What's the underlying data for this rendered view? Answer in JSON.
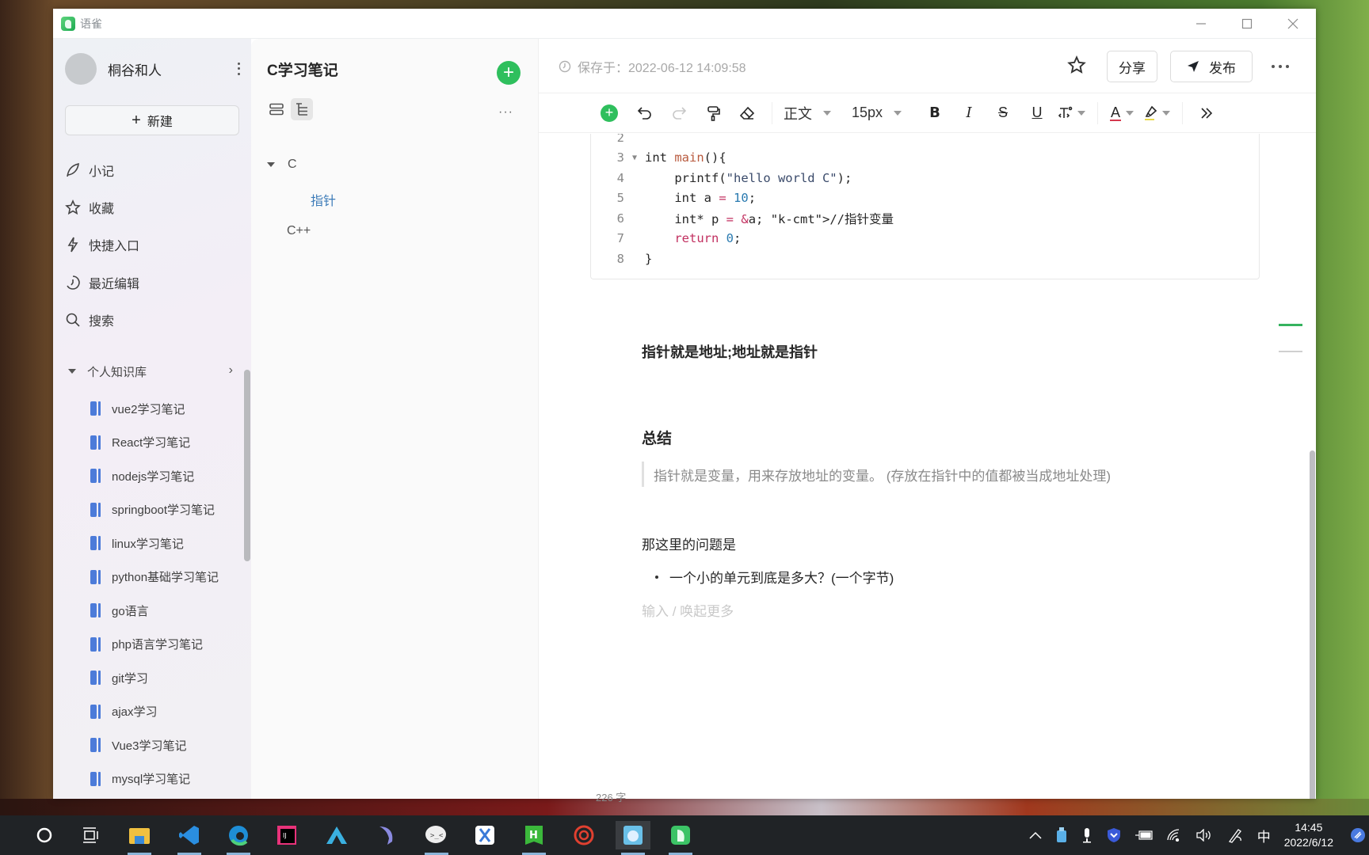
{
  "window": {
    "app_name": "语雀",
    "controls": [
      "minimize",
      "maximize",
      "close"
    ]
  },
  "sidebar": {
    "user_name": "桐谷和人",
    "new_label": "新建",
    "nav": [
      {
        "label": "小记",
        "icon": "feather-icon"
      },
      {
        "label": "收藏",
        "icon": "star-icon"
      },
      {
        "label": "快捷入口",
        "icon": "lightning-icon"
      },
      {
        "label": "最近编辑",
        "icon": "clock-icon"
      },
      {
        "label": "搜索",
        "icon": "search-icon"
      }
    ],
    "knowledge_base": {
      "title": "个人知识库",
      "books": [
        "vue2学习笔记",
        "React学习笔记",
        "nodejs学习笔记",
        "springboot学习笔记",
        "linux学习笔记",
        "python基础学习笔记",
        "go语言",
        "php语言学习笔记",
        "git学习",
        "ajax学习",
        "Vue3学习笔记",
        "mysql学习笔记"
      ]
    }
  },
  "doclist": {
    "title": "C学习笔记",
    "tree": [
      {
        "label": "C",
        "expanded": true,
        "level": 0
      },
      {
        "label": "指针",
        "level": 1,
        "selected": true
      },
      {
        "label": "C++",
        "level": 0
      }
    ]
  },
  "editor": {
    "save_status": "保存于：2022-06-12 14:09:58",
    "share_label": "分享",
    "publish_label": "发布",
    "toolbar": {
      "paragraph_style": "正文",
      "font_size": "15px",
      "bold": "B",
      "italic": "I",
      "strike": "S",
      "underline": "U",
      "font_color": "A"
    },
    "code": {
      "lines": [
        {
          "n": "2",
          "text": ""
        },
        {
          "n": "3",
          "fold": true,
          "text": "int main(){"
        },
        {
          "n": "4",
          "text": "    printf(\"hello world C\");"
        },
        {
          "n": "5",
          "text": "    int a = 10;"
        },
        {
          "n": "6",
          "text": "    int* p = &a; //指针变量"
        },
        {
          "n": "7",
          "text": "    return 0;"
        },
        {
          "n": "8",
          "text": "}"
        }
      ]
    },
    "bold_paragraph": "指针就是地址;地址就是指针",
    "heading": "总结",
    "quote": "指针就是变量，用来存放地址的变量。 (存放在指针中的值都被当成地址处理)",
    "paragraph": "那这里的问题是",
    "list_item": "一个小的单元到底是多大？(一个字节)",
    "placeholder": "输入 / 唤起更多",
    "word_count": "226 字"
  },
  "taskbar": {
    "apps": [
      "cortana",
      "task-view",
      "file-explorer",
      "vscode",
      "edge",
      "intellij",
      "app-a",
      "dolphin",
      "wechat",
      "xmind",
      "hbuilder",
      "netease",
      "live2d",
      "yuque"
    ],
    "tray": {
      "ime": "中",
      "time": "14:45",
      "date": "2022/6/12"
    }
  }
}
